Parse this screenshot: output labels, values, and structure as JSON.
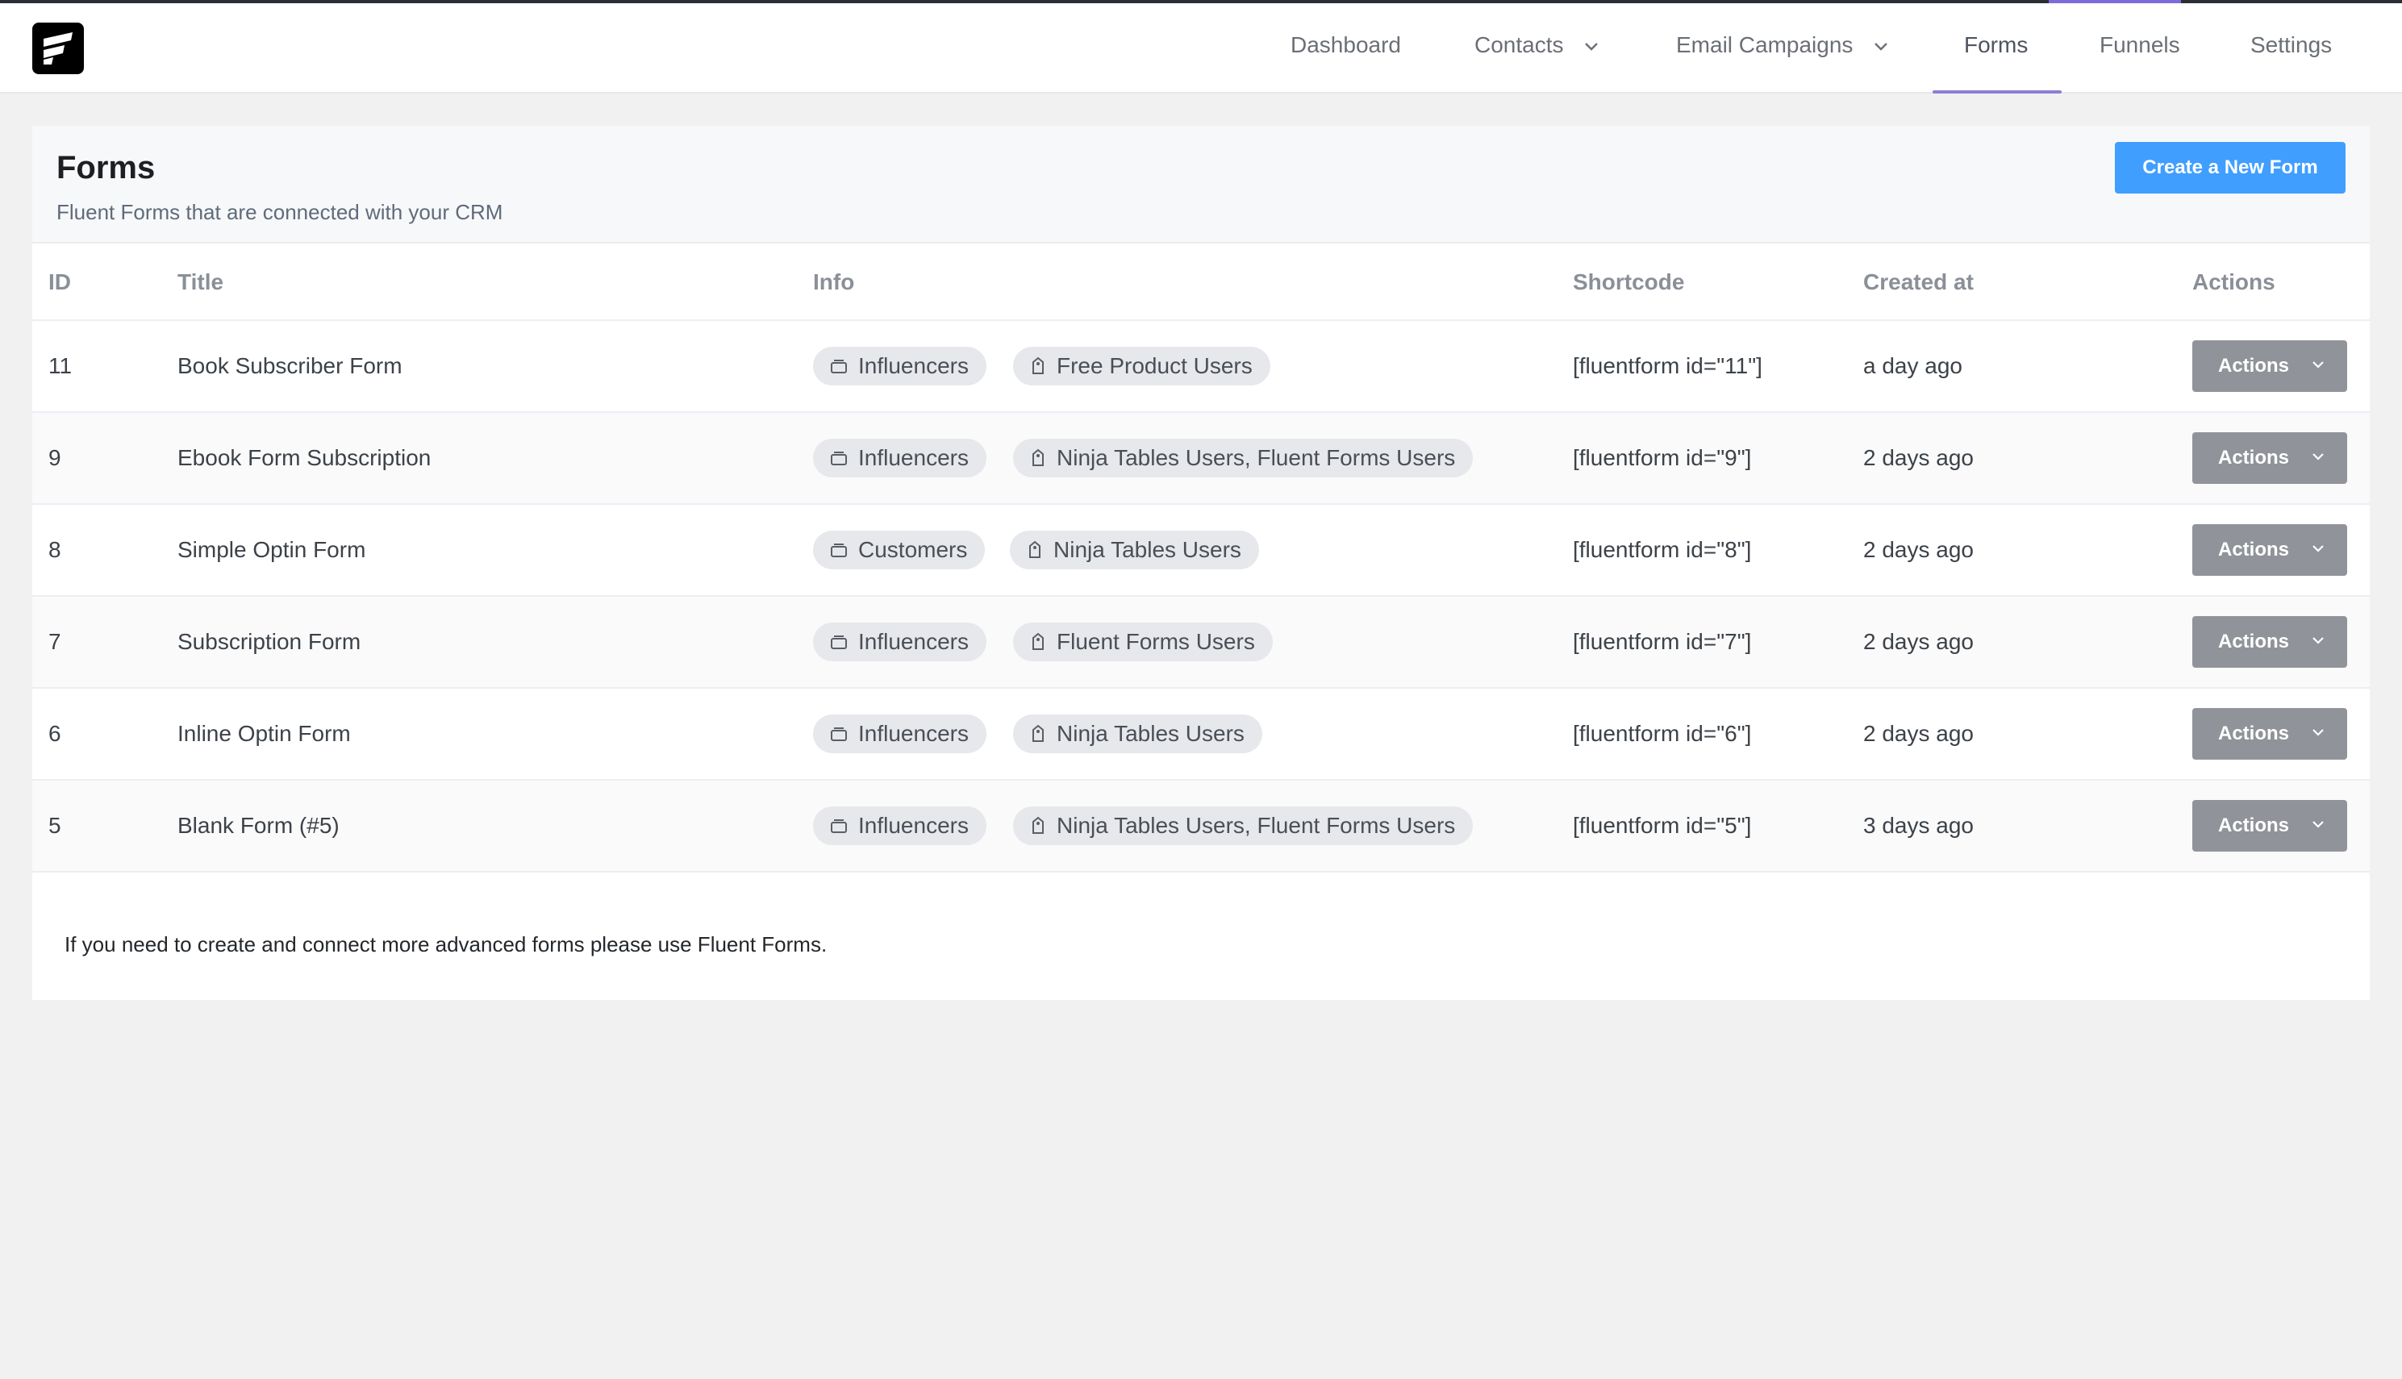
{
  "nav": {
    "items": [
      {
        "label": "Dashboard"
      },
      {
        "label": "Contacts",
        "dropdown": true
      },
      {
        "label": "Email Campaigns",
        "dropdown": true
      },
      {
        "label": "Forms",
        "active": true
      },
      {
        "label": "Funnels"
      },
      {
        "label": "Settings"
      }
    ],
    "accent": "#8b7fd6"
  },
  "header": {
    "title": "Forms",
    "subtitle": "Fluent Forms that are connected with your CRM",
    "create_label": "Create a New Form",
    "create_color": "#409eff"
  },
  "table": {
    "columns": [
      "ID",
      "Title",
      "Info",
      "Shortcode",
      "Created at",
      "Actions"
    ],
    "rows": [
      {
        "id": "11",
        "title": "Book Subscriber Form",
        "list": "Influencers",
        "tags": "Free Product Users",
        "shortcode": "[fluentform id=\"11\"]",
        "created": "a day ago",
        "action": "Actions"
      },
      {
        "id": "9",
        "title": "Ebook Form Subscription",
        "list": "Influencers",
        "tags": "Ninja Tables Users, Fluent Forms Users",
        "shortcode": "[fluentform id=\"9\"]",
        "created": "2 days ago",
        "action": "Actions"
      },
      {
        "id": "8",
        "title": "Simple Optin Form",
        "list": "Customers",
        "tags": "Ninja Tables Users",
        "shortcode": "[fluentform id=\"8\"]",
        "created": "2 days ago",
        "action": "Actions"
      },
      {
        "id": "7",
        "title": "Subscription Form",
        "list": "Influencers",
        "tags": "Fluent Forms Users",
        "shortcode": "[fluentform id=\"7\"]",
        "created": "2 days ago",
        "action": "Actions"
      },
      {
        "id": "6",
        "title": "Inline Optin Form",
        "list": "Influencers",
        "tags": "Ninja Tables Users",
        "shortcode": "[fluentform id=\"6\"]",
        "created": "2 days ago",
        "action": "Actions"
      },
      {
        "id": "5",
        "title": "Blank Form (#5)",
        "list": "Influencers",
        "tags": "Ninja Tables Users, Fluent Forms Users",
        "shortcode": "[fluentform id=\"5\"]",
        "created": "3 days ago",
        "action": "Actions"
      }
    ]
  },
  "footer": {
    "note": "If you need to create and connect more advanced forms please use Fluent Forms."
  }
}
